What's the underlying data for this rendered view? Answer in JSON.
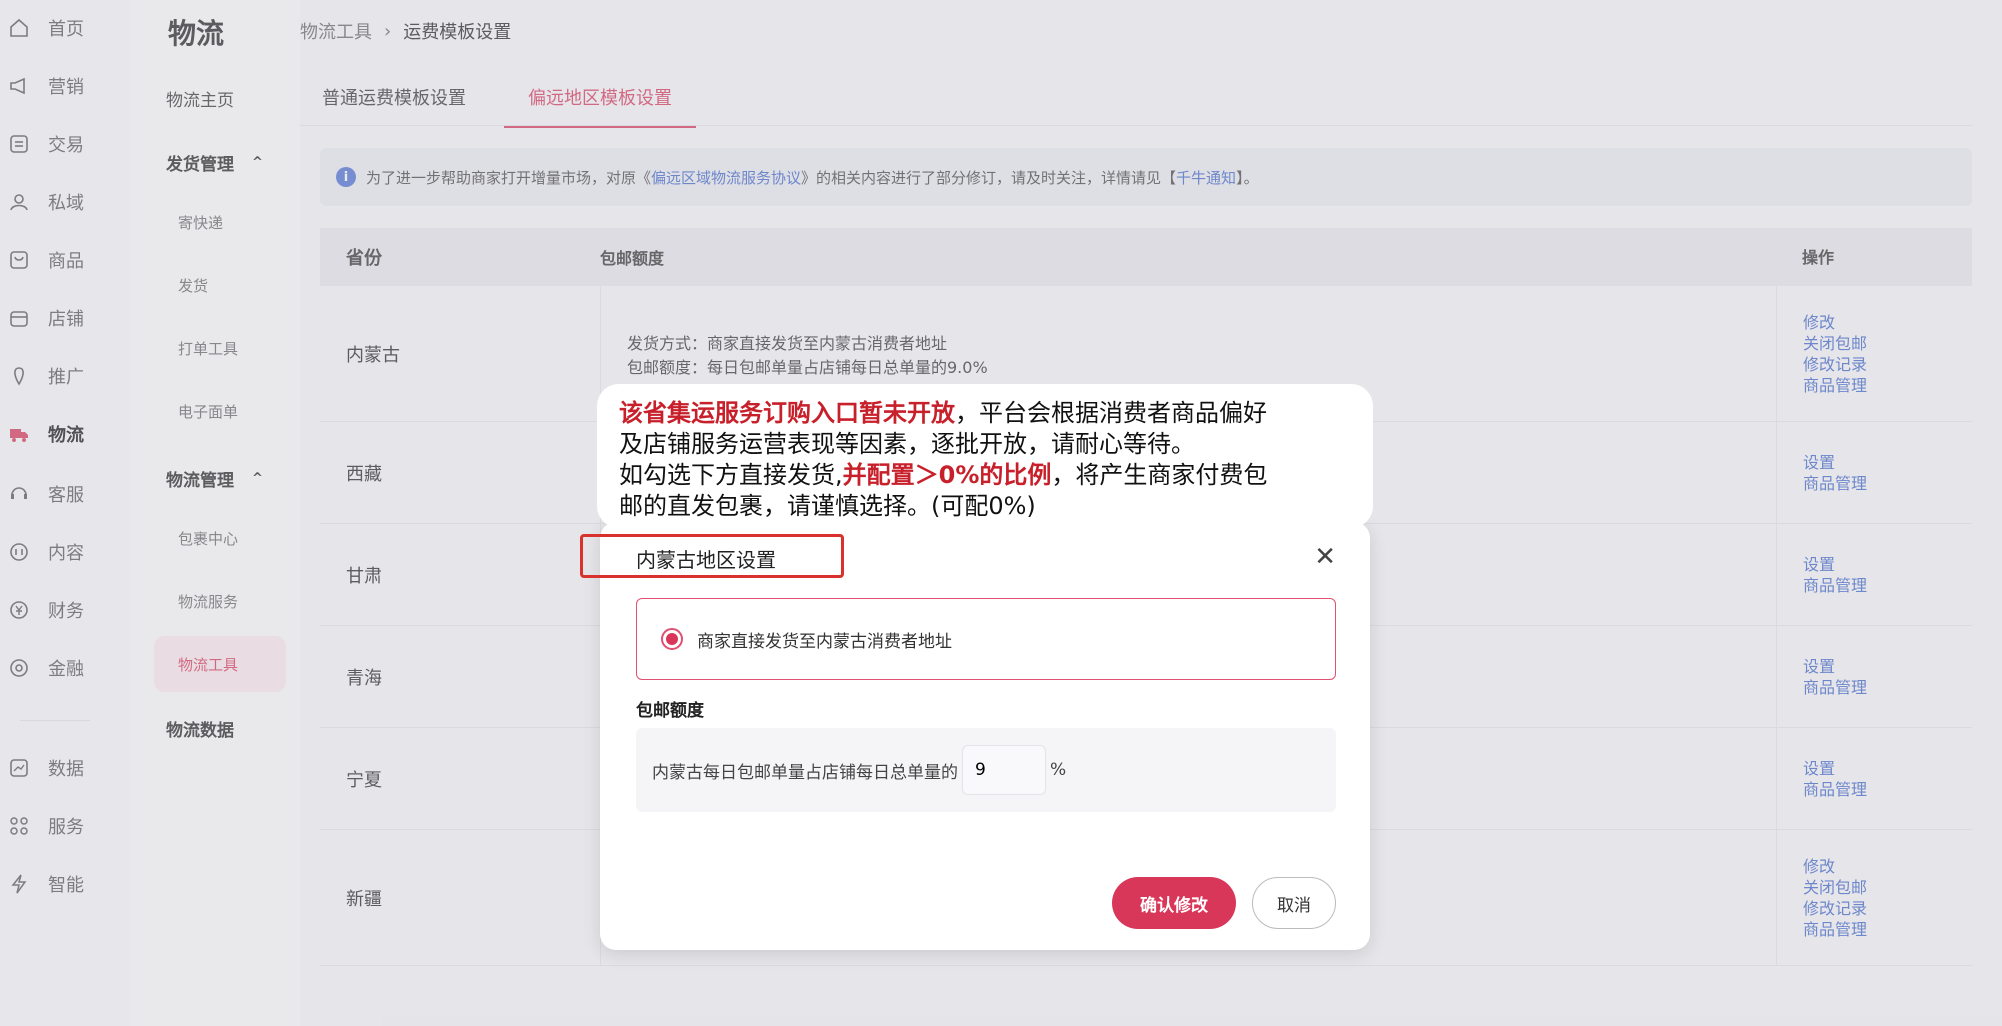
{
  "rail": {
    "items": [
      {
        "icon": "home-icon",
        "label": "首页"
      },
      {
        "icon": "megaphone-icon",
        "label": "营销"
      },
      {
        "icon": "trade-icon",
        "label": "交易"
      },
      {
        "icon": "private-domain-icon",
        "label": "私域"
      },
      {
        "icon": "product-icon",
        "label": "商品"
      },
      {
        "icon": "store-icon",
        "label": "店铺"
      },
      {
        "icon": "promote-icon",
        "label": "推广"
      },
      {
        "icon": "logistics-icon",
        "label": "物流"
      },
      {
        "icon": "service-icon",
        "label": "客服"
      },
      {
        "icon": "content-icon",
        "label": "内容"
      },
      {
        "icon": "finance-icon",
        "label": "财务"
      },
      {
        "icon": "fintech-icon",
        "label": "金融"
      },
      {
        "icon": "data-icon",
        "label": "数据"
      },
      {
        "icon": "services-grid-icon",
        "label": "服务"
      },
      {
        "icon": "smart-icon",
        "label": "智能"
      }
    ]
  },
  "sub": {
    "title": "物流",
    "home": "物流主页",
    "ship_group": "发货管理",
    "ship_children": [
      "寄快递",
      "发货",
      "打单工具",
      "电子面单"
    ],
    "log_group": "物流管理",
    "log_children": [
      "包裹中心",
      "物流服务",
      "物流工具"
    ],
    "data": "物流数据"
  },
  "breadcrumb": {
    "parent": "物流工具",
    "sep": "›",
    "current": "运费模板设置"
  },
  "tabs": [
    "普通运费模板设置",
    "偏远地区模板设置"
  ],
  "notice": {
    "pre": "为了进一步帮助商家打开增量市场，对原《",
    "link1": "偏远区域物流服务协议",
    "mid": "》的相关内容进行了部分修订，请及时关注，详情请见【",
    "link2": "千牛通知",
    "post": "】。"
  },
  "table": {
    "headers": [
      "省份",
      "包邮额度",
      "操作"
    ],
    "rows": [
      {
        "province": "内蒙古",
        "detail": [
          "发货方式：商家直接发货至内蒙古消费者地址",
          "包邮额度：每日包邮单量占店铺每日总单量的9.0%"
        ],
        "actions": [
          "修改",
          "关闭包邮",
          "修改记录",
          "商品管理"
        ]
      },
      {
        "province": "西藏",
        "detail": [],
        "actions": [
          "设置",
          "商品管理"
        ]
      },
      {
        "province": "甘肃",
        "detail": [],
        "actions": [
          "设置",
          "商品管理"
        ]
      },
      {
        "province": "青海",
        "detail": [],
        "actions": [
          "设置",
          "商品管理"
        ]
      },
      {
        "province": "宁夏",
        "detail": [],
        "actions": [
          "设置",
          "商品管理"
        ]
      },
      {
        "province": "新疆",
        "detail": [],
        "actions": [
          "修改",
          "关闭包邮",
          "修改记录",
          "商品管理"
        ]
      }
    ]
  },
  "callout": {
    "l1_red": "该省集运服务订购入口暂未开放",
    "l1_rest": "，平台会根据消费者商品偏好",
    "l2": "及店铺服务运营表现等因素，逐批开放，请耐心等待。",
    "l3_pre": "如勾选下方直接发货,",
    "l3_red": "并配置＞0%的比例",
    "l3_post": "，将产生商家付费包",
    "l4": "邮的直发包裹，请谨慎选择。(可配0%)"
  },
  "modal": {
    "title": "内蒙古地区设置",
    "option": "商家直接发货至内蒙古消费者地址",
    "quota_label": "包邮额度",
    "quota_text": "内蒙古每日包邮单量占店铺每日总单量的",
    "quota_value": "9",
    "quota_unit": "%",
    "confirm": "确认修改",
    "cancel": "取消"
  },
  "colors": {
    "accent": "#d8375a",
    "link": "#3d64c8",
    "callout_red": "#c8202a"
  }
}
